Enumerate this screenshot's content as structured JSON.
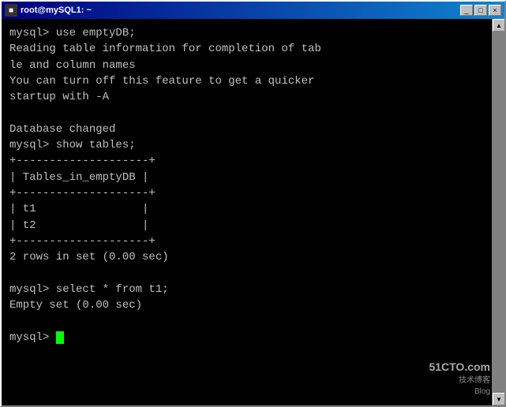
{
  "window": {
    "title": "root@mySQL1: ~",
    "minimize_label": "_",
    "maximize_label": "□",
    "close_label": "×"
  },
  "terminal": {
    "lines": [
      "mysql> use emptyDB;",
      "Reading table information for completion of tab",
      "le and column names",
      "You can turn off this feature to get a quicker",
      "startup with -A",
      "",
      "Database changed",
      "mysql> show tables;",
      "+--------------------+",
      "| Tables_in_emptyDB |",
      "+--------------------+",
      "| t1                |",
      "| t2                |",
      "+--------------------+",
      "2 rows in set (0.00 sec)",
      "",
      "mysql> select * from t1;",
      "Empty set (0.00 sec)",
      "",
      "mysql> "
    ],
    "prompt": "mysql> "
  },
  "watermark": {
    "main": "51CTO.com",
    "sub": "技术博客",
    "blog": "Blog"
  }
}
